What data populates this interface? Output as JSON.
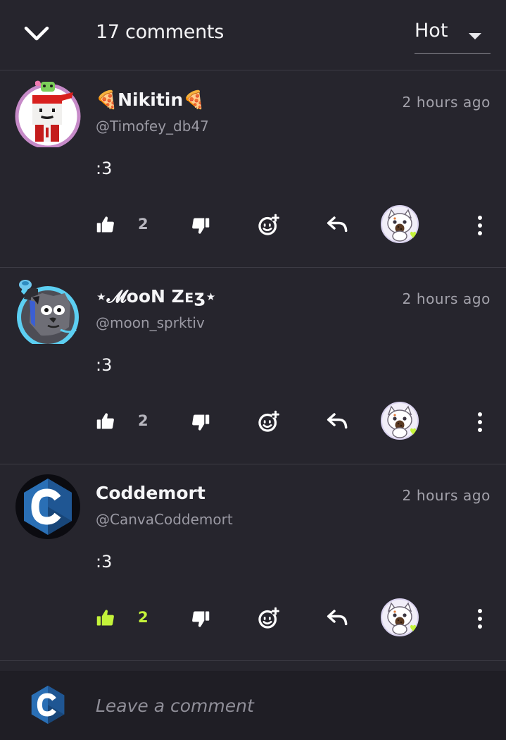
{
  "header": {
    "comment_count_label": "17 comments",
    "sort_value": "Hot"
  },
  "colors": {
    "background": "#26252d",
    "footer": "#1f1e25",
    "accent_like": "#c4f33a",
    "divider": "#3c3b44"
  },
  "comments": [
    {
      "author": "🍕Nikitin🍕",
      "handle": "@Timofey_db47",
      "time": "2 hours ago",
      "text": ":3",
      "likes": "2",
      "liked": false,
      "avatar_icon": "pixel-character-avatar"
    },
    {
      "author": "⋆𝓜ᴏᴏN Zᴇʒ⋆",
      "handle": "@moon_sprktiv",
      "time": "2 hours ago",
      "text": ":3",
      "likes": "2",
      "liked": false,
      "avatar_icon": "cartoon-wolf-avatar"
    },
    {
      "author": "Coddemort",
      "handle": "@CanvaCoddemort",
      "time": "2 hours ago",
      "text": ":3",
      "likes": "2",
      "liked": true,
      "avatar_icon": "c-language-logo-avatar"
    }
  ],
  "composer": {
    "placeholder": "Leave a comment"
  }
}
